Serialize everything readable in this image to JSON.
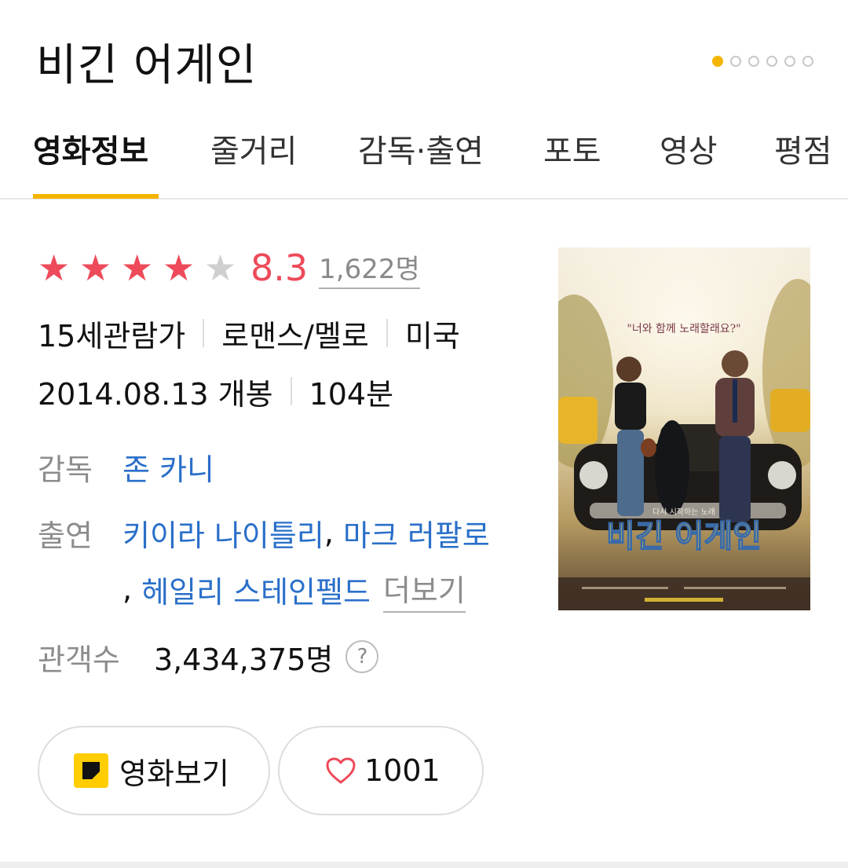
{
  "header": {
    "title": "비긴 어게인",
    "pager": {
      "count": 6,
      "active_index": 0
    }
  },
  "tabs": [
    {
      "label": "영화정보",
      "active": true
    },
    {
      "label": "줄거리",
      "active": false
    },
    {
      "label": "감독·출연",
      "active": false
    },
    {
      "label": "포토",
      "active": false
    },
    {
      "label": "영상",
      "active": false
    },
    {
      "label": "평점",
      "active": false
    }
  ],
  "rating": {
    "stars_filled": 4,
    "stars_total": 5,
    "score": "8.3",
    "count": "1,622명"
  },
  "info": {
    "age_rating": "15세관람가",
    "genre": "로맨스/멜로",
    "country": "미국",
    "release": "2014.08.13 개봉",
    "runtime": "104분",
    "director_label": "감독",
    "director": "존 카니",
    "cast_label": "출연",
    "cast": [
      "키이라 나이틀리",
      "마크 러팔로",
      "헤일리 스테인펠드"
    ],
    "more_label": "더보기",
    "audience_label": "관객수",
    "audience": "3,434,375명",
    "help_icon": "?"
  },
  "poster": {
    "tagline": "\"너와 함께 노래할래요?\"",
    "subtitle": "다시 시작하는 노래",
    "title": "비긴 어게인"
  },
  "buttons": {
    "watch_label": "영화보기",
    "like_count": "1001"
  },
  "colors": {
    "accent": "#f5b400",
    "rating_red": "#ee4a5a",
    "link_blue": "#2a6fc9"
  }
}
